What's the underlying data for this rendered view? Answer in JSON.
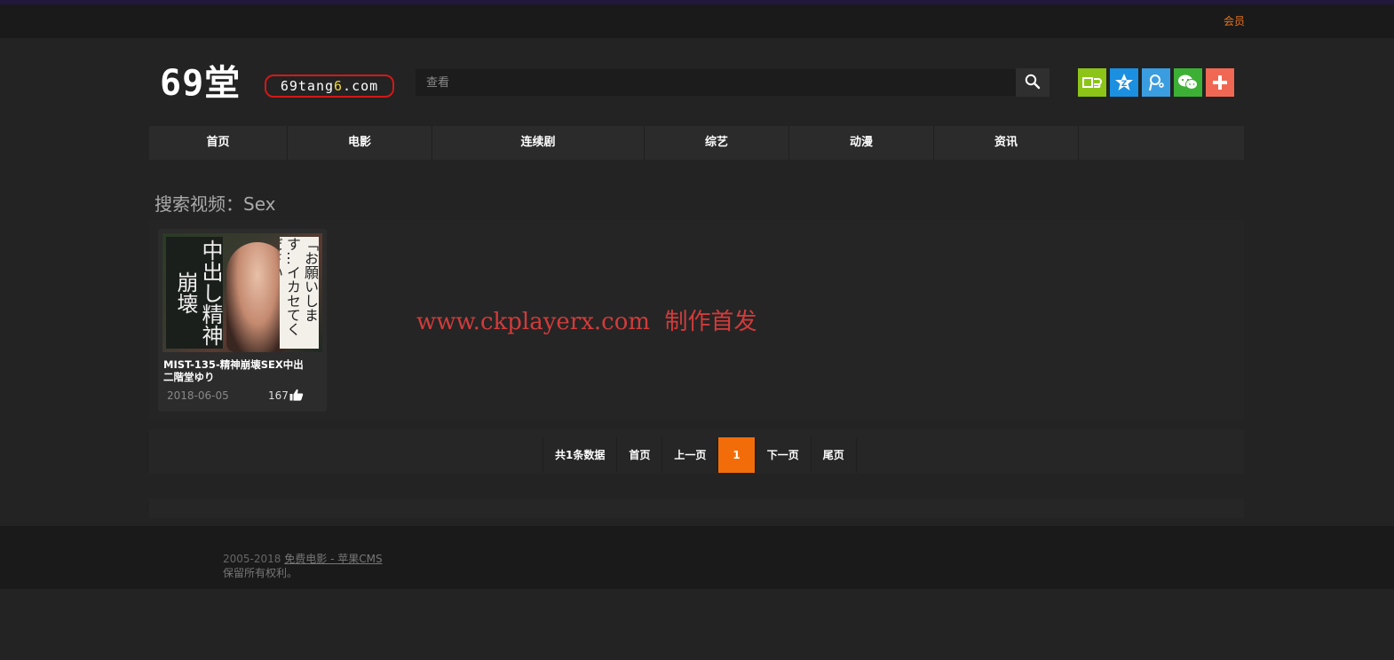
{
  "topbar": {
    "member_link": "会员"
  },
  "header": {
    "logo_text": "69堂",
    "logo_url_prefix": "69tang",
    "logo_url_accent": "6",
    "logo_url_suffix": ".com",
    "search_placeholder": "查看",
    "share_icons": [
      {
        "name": "share-icon-1",
        "color": "#8cc418"
      },
      {
        "name": "qzone-icon",
        "color": "#1b8fe0"
      },
      {
        "name": "tencent-weibo-icon",
        "color": "#3a9de0"
      },
      {
        "name": "wechat-icon",
        "color": "#3cb034"
      },
      {
        "name": "more-plus-icon",
        "color": "#f06853"
      }
    ]
  },
  "nav": {
    "items": [
      {
        "label": "首页"
      },
      {
        "label": "电影"
      },
      {
        "label": "连续剧"
      },
      {
        "label": "综艺"
      },
      {
        "label": "动漫"
      },
      {
        "label": "资讯"
      }
    ]
  },
  "search": {
    "title": "搜索视频：Sex"
  },
  "results": [
    {
      "title": "MIST-135-精神崩壊SEX中出 二階堂ゆり",
      "date": "2018-06-05",
      "likes": "167",
      "thumb_left_text": "中出し精神崩壊",
      "thumb_right_text": "「お願いします…イカセてください…」"
    }
  ],
  "watermark": "www.ckplayerx.com  制作首发",
  "pagination": {
    "total": "共1条数据",
    "first": "首页",
    "prev": "上一页",
    "current": "1",
    "next": "下一页",
    "last": "尾页"
  },
  "footer": {
    "years": "2005-2018",
    "link": "免费电影 - 苹果CMS",
    "rights": "保留所有权利。"
  },
  "colors": {
    "accent": "#f26d0a",
    "member_link": "#e8741a",
    "watermark": "#d23b3b"
  }
}
